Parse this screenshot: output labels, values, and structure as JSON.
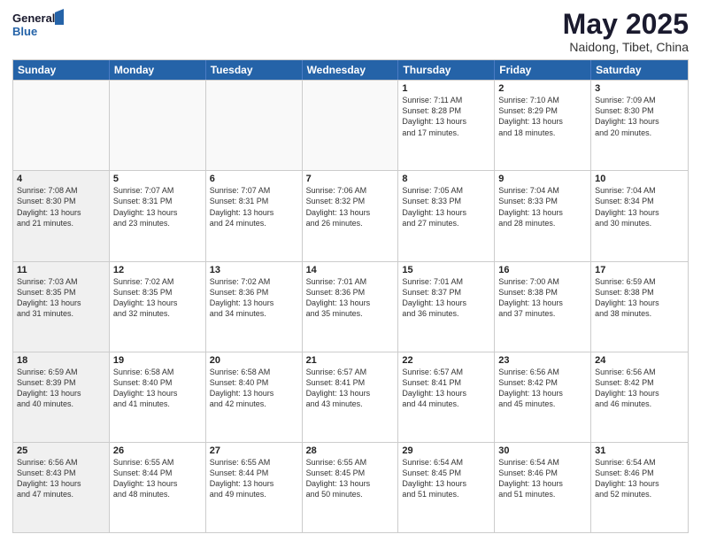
{
  "header": {
    "logo_line1": "General",
    "logo_line2": "Blue",
    "title": "May 2025",
    "subtitle": "Naidong, Tibet, China"
  },
  "weekdays": [
    "Sunday",
    "Monday",
    "Tuesday",
    "Wednesday",
    "Thursday",
    "Friday",
    "Saturday"
  ],
  "rows": [
    [
      {
        "day": "",
        "info": "",
        "shaded": true
      },
      {
        "day": "",
        "info": "",
        "shaded": true
      },
      {
        "day": "",
        "info": "",
        "shaded": true
      },
      {
        "day": "",
        "info": "",
        "shaded": true
      },
      {
        "day": "1",
        "info": "Sunrise: 7:11 AM\nSunset: 8:28 PM\nDaylight: 13 hours\nand 17 minutes.",
        "shaded": false
      },
      {
        "day": "2",
        "info": "Sunrise: 7:10 AM\nSunset: 8:29 PM\nDaylight: 13 hours\nand 18 minutes.",
        "shaded": false
      },
      {
        "day": "3",
        "info": "Sunrise: 7:09 AM\nSunset: 8:30 PM\nDaylight: 13 hours\nand 20 minutes.",
        "shaded": false
      }
    ],
    [
      {
        "day": "4",
        "info": "Sunrise: 7:08 AM\nSunset: 8:30 PM\nDaylight: 13 hours\nand 21 minutes.",
        "shaded": true
      },
      {
        "day": "5",
        "info": "Sunrise: 7:07 AM\nSunset: 8:31 PM\nDaylight: 13 hours\nand 23 minutes.",
        "shaded": false
      },
      {
        "day": "6",
        "info": "Sunrise: 7:07 AM\nSunset: 8:31 PM\nDaylight: 13 hours\nand 24 minutes.",
        "shaded": false
      },
      {
        "day": "7",
        "info": "Sunrise: 7:06 AM\nSunset: 8:32 PM\nDaylight: 13 hours\nand 26 minutes.",
        "shaded": false
      },
      {
        "day": "8",
        "info": "Sunrise: 7:05 AM\nSunset: 8:33 PM\nDaylight: 13 hours\nand 27 minutes.",
        "shaded": false
      },
      {
        "day": "9",
        "info": "Sunrise: 7:04 AM\nSunset: 8:33 PM\nDaylight: 13 hours\nand 28 minutes.",
        "shaded": false
      },
      {
        "day": "10",
        "info": "Sunrise: 7:04 AM\nSunset: 8:34 PM\nDaylight: 13 hours\nand 30 minutes.",
        "shaded": false
      }
    ],
    [
      {
        "day": "11",
        "info": "Sunrise: 7:03 AM\nSunset: 8:35 PM\nDaylight: 13 hours\nand 31 minutes.",
        "shaded": true
      },
      {
        "day": "12",
        "info": "Sunrise: 7:02 AM\nSunset: 8:35 PM\nDaylight: 13 hours\nand 32 minutes.",
        "shaded": false
      },
      {
        "day": "13",
        "info": "Sunrise: 7:02 AM\nSunset: 8:36 PM\nDaylight: 13 hours\nand 34 minutes.",
        "shaded": false
      },
      {
        "day": "14",
        "info": "Sunrise: 7:01 AM\nSunset: 8:36 PM\nDaylight: 13 hours\nand 35 minutes.",
        "shaded": false
      },
      {
        "day": "15",
        "info": "Sunrise: 7:01 AM\nSunset: 8:37 PM\nDaylight: 13 hours\nand 36 minutes.",
        "shaded": false
      },
      {
        "day": "16",
        "info": "Sunrise: 7:00 AM\nSunset: 8:38 PM\nDaylight: 13 hours\nand 37 minutes.",
        "shaded": false
      },
      {
        "day": "17",
        "info": "Sunrise: 6:59 AM\nSunset: 8:38 PM\nDaylight: 13 hours\nand 38 minutes.",
        "shaded": false
      }
    ],
    [
      {
        "day": "18",
        "info": "Sunrise: 6:59 AM\nSunset: 8:39 PM\nDaylight: 13 hours\nand 40 minutes.",
        "shaded": true
      },
      {
        "day": "19",
        "info": "Sunrise: 6:58 AM\nSunset: 8:40 PM\nDaylight: 13 hours\nand 41 minutes.",
        "shaded": false
      },
      {
        "day": "20",
        "info": "Sunrise: 6:58 AM\nSunset: 8:40 PM\nDaylight: 13 hours\nand 42 minutes.",
        "shaded": false
      },
      {
        "day": "21",
        "info": "Sunrise: 6:57 AM\nSunset: 8:41 PM\nDaylight: 13 hours\nand 43 minutes.",
        "shaded": false
      },
      {
        "day": "22",
        "info": "Sunrise: 6:57 AM\nSunset: 8:41 PM\nDaylight: 13 hours\nand 44 minutes.",
        "shaded": false
      },
      {
        "day": "23",
        "info": "Sunrise: 6:56 AM\nSunset: 8:42 PM\nDaylight: 13 hours\nand 45 minutes.",
        "shaded": false
      },
      {
        "day": "24",
        "info": "Sunrise: 6:56 AM\nSunset: 8:42 PM\nDaylight: 13 hours\nand 46 minutes.",
        "shaded": false
      }
    ],
    [
      {
        "day": "25",
        "info": "Sunrise: 6:56 AM\nSunset: 8:43 PM\nDaylight: 13 hours\nand 47 minutes.",
        "shaded": true
      },
      {
        "day": "26",
        "info": "Sunrise: 6:55 AM\nSunset: 8:44 PM\nDaylight: 13 hours\nand 48 minutes.",
        "shaded": false
      },
      {
        "day": "27",
        "info": "Sunrise: 6:55 AM\nSunset: 8:44 PM\nDaylight: 13 hours\nand 49 minutes.",
        "shaded": false
      },
      {
        "day": "28",
        "info": "Sunrise: 6:55 AM\nSunset: 8:45 PM\nDaylight: 13 hours\nand 50 minutes.",
        "shaded": false
      },
      {
        "day": "29",
        "info": "Sunrise: 6:54 AM\nSunset: 8:45 PM\nDaylight: 13 hours\nand 51 minutes.",
        "shaded": false
      },
      {
        "day": "30",
        "info": "Sunrise: 6:54 AM\nSunset: 8:46 PM\nDaylight: 13 hours\nand 51 minutes.",
        "shaded": false
      },
      {
        "day": "31",
        "info": "Sunrise: 6:54 AM\nSunset: 8:46 PM\nDaylight: 13 hours\nand 52 minutes.",
        "shaded": false
      }
    ]
  ]
}
